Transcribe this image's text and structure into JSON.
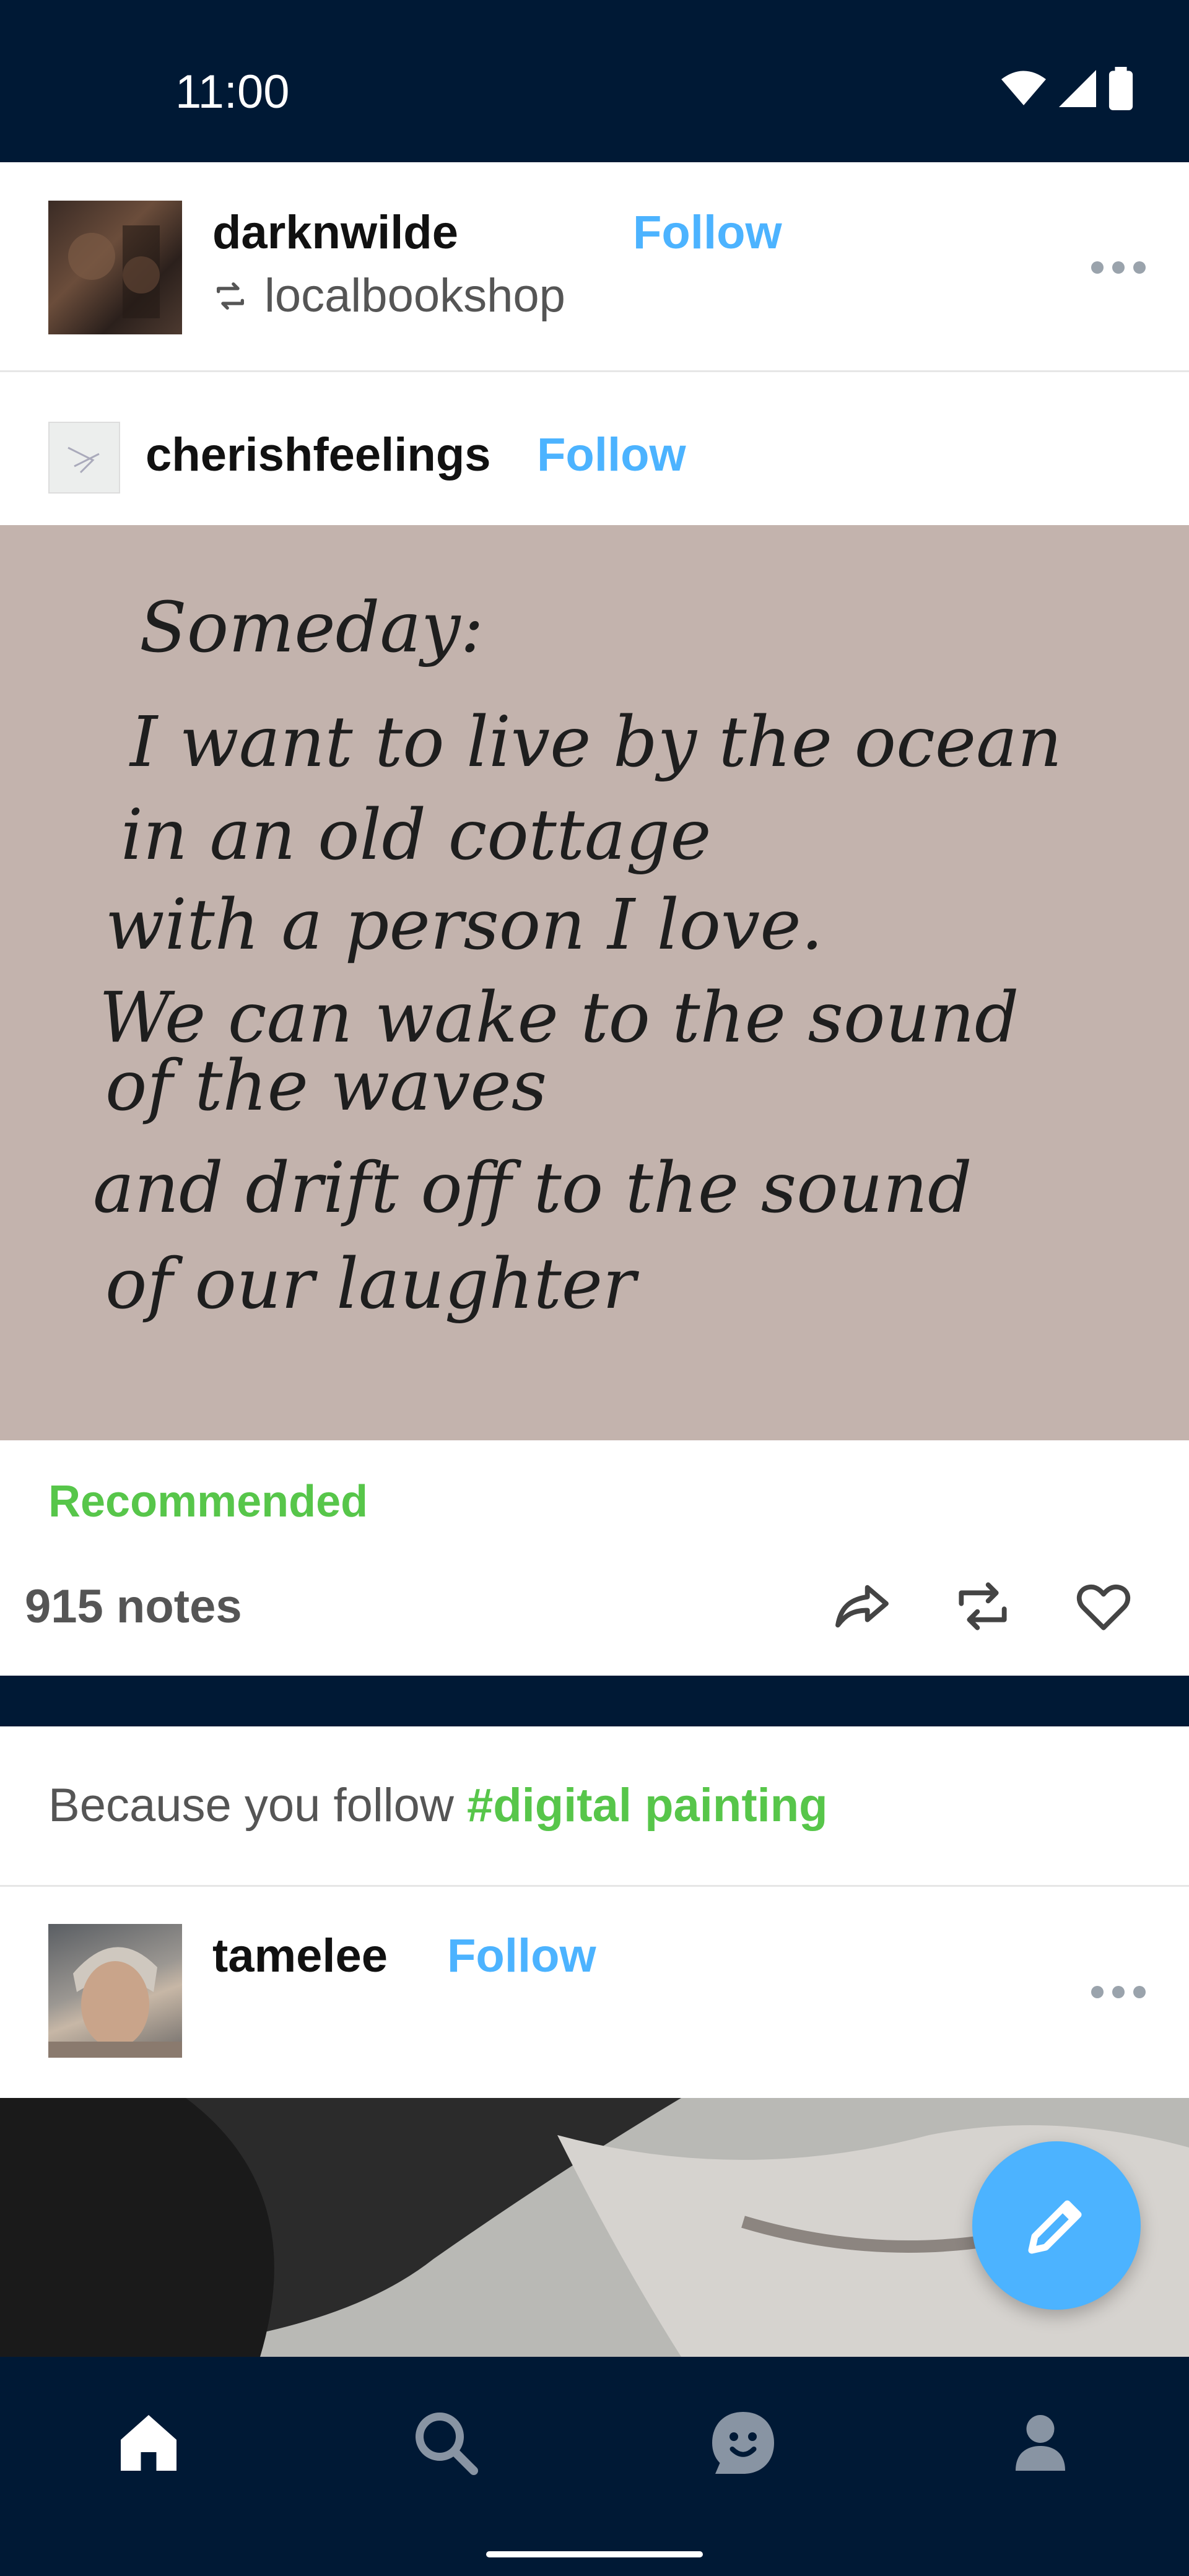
{
  "status_bar": {
    "time": "11:00",
    "icons": [
      "wifi-icon",
      "cellular-signal-icon",
      "battery-icon"
    ]
  },
  "reblog_header": {
    "username": "darknwilde",
    "follow_label": "Follow",
    "reblogged_from": "localbookshop",
    "more_icon": "more-options-icon"
  },
  "source_header": {
    "username": "cherishfeelings",
    "follow_label": "Follow"
  },
  "note_image": {
    "lines": [
      "Someday:",
      "I want to live by the ocean",
      "in an old cottage",
      "with a person I love.",
      "We can wake to the sound",
      "of the waves",
      "and drift off to the sound",
      "of our laughter"
    ]
  },
  "post_footer": {
    "recommended_label": "Recommended",
    "notes_label": "915 notes",
    "actions": [
      "share-icon",
      "reblog-icon",
      "like-icon"
    ]
  },
  "recommendation": {
    "prefix": "Because you follow ",
    "tag": "#digital painting"
  },
  "next_post_header": {
    "username": "tamelee",
    "follow_label": "Follow",
    "more_icon": "more-options-icon"
  },
  "fab": {
    "icon": "compose-pencil-icon"
  },
  "bottom_nav": {
    "items": [
      "home-icon",
      "search-icon",
      "activity-face-icon",
      "account-icon"
    ],
    "active": "home-icon"
  },
  "colors": {
    "navy": "#001935",
    "accent_blue": "#4cb3ff",
    "tag_green": "#57c64a"
  }
}
